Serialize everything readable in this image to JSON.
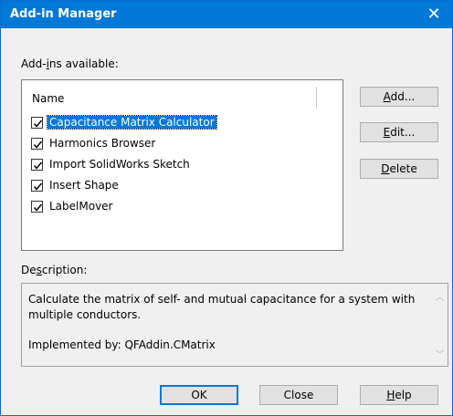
{
  "window": {
    "title": "Add-in Manager",
    "close_glyph": "✕"
  },
  "addins": {
    "label_prefix": "Add-",
    "label_u": "i",
    "label_suffix": "ns available:",
    "column_header": "Name",
    "items": [
      {
        "label": "Capacitance Matrix Calculator",
        "checked": true,
        "selected": true
      },
      {
        "label": "Harmonics Browser",
        "checked": true,
        "selected": false
      },
      {
        "label": "Import SolidWorks Sketch",
        "checked": true,
        "selected": false
      },
      {
        "label": "Insert Shape",
        "checked": true,
        "selected": false
      },
      {
        "label": "LabelMover",
        "checked": true,
        "selected": false
      }
    ]
  },
  "side_buttons": {
    "add": {
      "u": "A",
      "rest": "dd..."
    },
    "edit": {
      "u": "E",
      "rest": "dit..."
    },
    "delete": {
      "u": "D",
      "rest": "elete"
    }
  },
  "description": {
    "label_prefix": "De",
    "label_u": "s",
    "label_suffix": "cription:",
    "text": "Calculate the matrix of self- and mutual capacitance for a system with multiple conductors.",
    "implemented": "Implemented by: QFAddin.CMatrix"
  },
  "bottom_buttons": {
    "ok": "OK",
    "close": "Close",
    "help_u": "H",
    "help_rest": "elp"
  },
  "colors": {
    "accent": "#0078d7",
    "dialog_bg": "#f0f0f0"
  }
}
